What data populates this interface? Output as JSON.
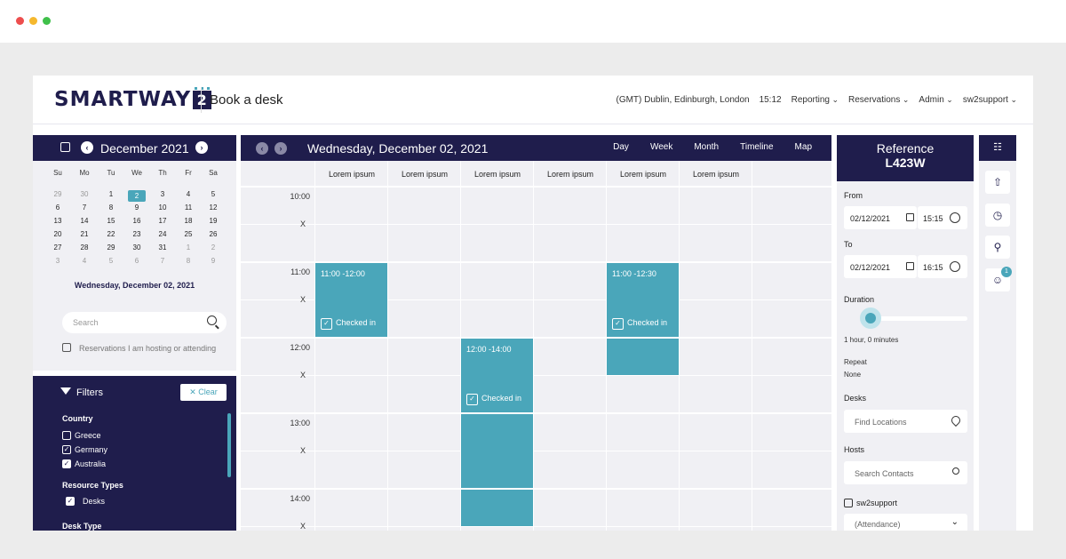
{
  "header": {
    "brand": "SMARTWAY",
    "brand_num": "2",
    "title": "Book a desk",
    "timezone": "(GMT) Dublin, Edinburgh, London",
    "time": "15:12",
    "menu": [
      "Reporting",
      "Reservations",
      "Admin",
      "sw2support"
    ]
  },
  "mini_calendar": {
    "month": "December 2021",
    "dow": [
      "Su",
      "Mo",
      "Tu",
      "We",
      "Th",
      "Fr",
      "Sa"
    ],
    "weeks": [
      [
        "29",
        "30",
        "1",
        "2",
        "3",
        "4",
        "5"
      ],
      [
        "6",
        "7",
        "8",
        "9",
        "10",
        "11",
        "12"
      ],
      [
        "13",
        "14",
        "15",
        "16",
        "17",
        "18",
        "19"
      ],
      [
        "20",
        "21",
        "22",
        "23",
        "24",
        "25",
        "26"
      ],
      [
        "27",
        "28",
        "29",
        "30",
        "31",
        "1",
        "2"
      ],
      [
        "3",
        "4",
        "5",
        "6",
        "7",
        "8",
        "9"
      ]
    ],
    "selected_date": "Wednesday, December 02, 2021"
  },
  "search": {
    "placeholder": "Search",
    "hosting_label": "Reservations I am hosting or attending"
  },
  "filters": {
    "title": "Filters",
    "clear": "Clear",
    "country_label": "Country",
    "countries": [
      {
        "name": "Greece",
        "checked": false
      },
      {
        "name": "Germany",
        "checked": true
      },
      {
        "name": "Australia",
        "checked": true
      }
    ],
    "resource_label": "Resource Types",
    "resources": [
      {
        "name": "Desks",
        "checked": true
      }
    ],
    "desk_type_label": "Desk Type"
  },
  "calendar": {
    "title": "Wednesday, December 02, 2021",
    "views": [
      "Day",
      "Week",
      "Month",
      "Timeline",
      "Map"
    ],
    "columns": [
      "Lorem ipsum",
      "Lorem ipsum",
      "Lorem ipsum",
      "Lorem ipsum",
      "Lorem ipsum",
      "Lorem ipsum"
    ],
    "times": [
      "10:00",
      "11:00",
      "12:00",
      "13:00",
      "14:00"
    ],
    "marker": "X",
    "events": [
      {
        "time": "11:00 -12:00",
        "status": "Checked in"
      },
      {
        "time": "11:00 -12:30",
        "status": "Checked in"
      },
      {
        "time": "12:00 -14:00",
        "status": "Checked in"
      }
    ]
  },
  "reservation": {
    "ref_label": "Reference",
    "ref": "L423W",
    "from_label": "From",
    "from_date": "02/12/2021",
    "from_time": "15:15",
    "to_label": "To",
    "to_date": "02/12/2021",
    "to_time": "16:15",
    "duration_label": "Duration",
    "duration": "1 hour, 0 minutes",
    "repeat_label": "Repeat",
    "repeat": "None",
    "desks_label": "Desks",
    "desks_placeholder": "Find Locations",
    "hosts_label": "Hosts",
    "hosts_placeholder": "Search Contacts",
    "host_name": "sw2support",
    "attendance": "(Attendance)"
  },
  "rail": {
    "badge": "1"
  },
  "colors": {
    "navy": "#1f1d4c",
    "teal": "#4aa6ba",
    "panel": "#f0f0f4"
  }
}
